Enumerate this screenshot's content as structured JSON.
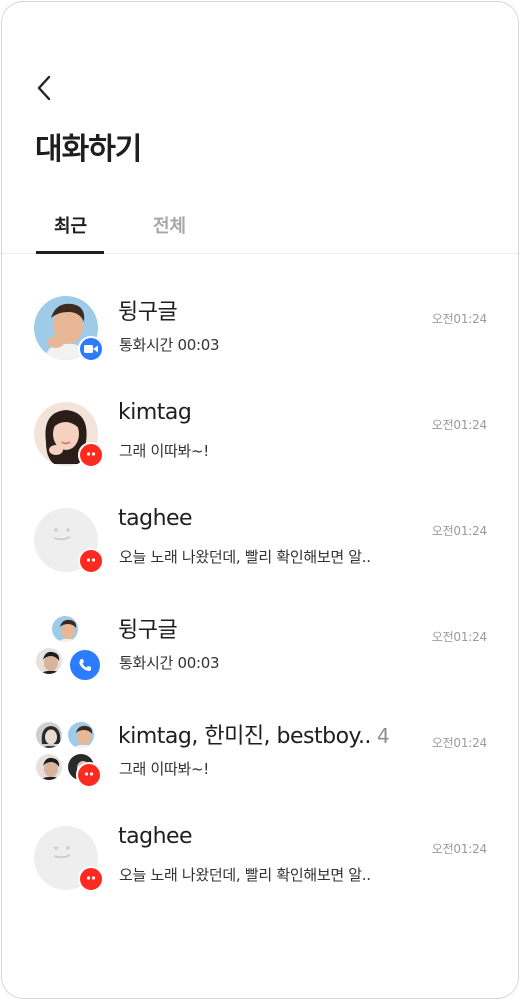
{
  "header": {
    "back_icon": "chevron-left-icon",
    "title": "대화하기"
  },
  "tabs": [
    {
      "label": "최근",
      "active": true
    },
    {
      "label": "전체",
      "active": false
    }
  ],
  "chats": [
    {
      "name": "뒹구글",
      "count": "",
      "preview": "통화시간 00:03",
      "time": "오전01:24",
      "badge": "video-call-icon",
      "badge_color": "#2b7cff"
    },
    {
      "name": "kimtag",
      "count": "",
      "preview": "그래 이따봐~!",
      "time": "오전01:24",
      "badge": "chat-bubble-icon",
      "badge_color": "#ff2a1f"
    },
    {
      "name": "taghee",
      "count": "",
      "preview": "오늘 노래 나왔던데, 빨리 확인해보면 알..",
      "time": "오전01:24",
      "badge": "chat-bubble-icon",
      "badge_color": "#ff2a1f"
    },
    {
      "name": "뒹구글",
      "count": "",
      "preview": "통화시간 00:03",
      "time": "오전01:24",
      "badge": "phone-icon",
      "badge_color": "#2b7cff"
    },
    {
      "name": "kimtag, 한미진, bestboy..",
      "count": "4",
      "preview": "그래 이따봐~!",
      "time": "오전01:24",
      "badge": "chat-bubble-icon",
      "badge_color": "#ff2a1f"
    },
    {
      "name": "taghee",
      "count": "",
      "preview": "오늘 노래 나왔던데, 빨리 확인해보면 알..",
      "time": "오전01:24",
      "badge": "chat-bubble-icon",
      "badge_color": "#ff2a1f"
    }
  ]
}
